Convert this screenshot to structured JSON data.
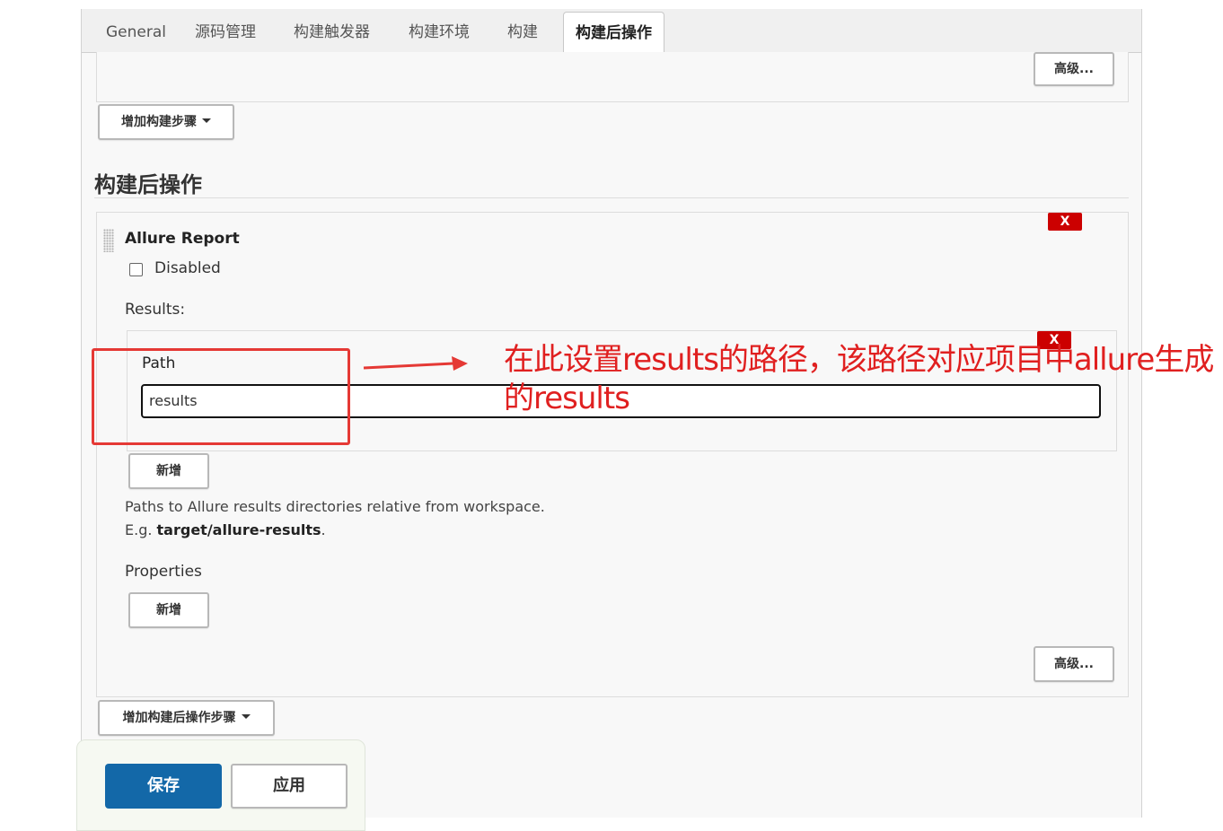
{
  "tabs": [
    "General",
    "源码管理",
    "构建触发器",
    "构建环境",
    "构建",
    "构建后操作"
  ],
  "active_tab": "构建后操作",
  "build_section": {
    "advanced_label": "高级...",
    "add_build_step_label": "增加构建步骤"
  },
  "post_build": {
    "title": "构建后操作",
    "allure": {
      "name": "Allure Report",
      "remove_label": "X",
      "disabled_label": "Disabled",
      "disabled_checked": false,
      "results_label": "Results:",
      "path_remove_label": "X",
      "path_label": "Path",
      "path_value": "results",
      "add_result_label": "新增",
      "help_line1": "Paths to Allure results directories relative from workspace.",
      "help_eg_prefix": "E.g.",
      "help_eg_value": "target/allure-results",
      "help_eg_suffix": ".",
      "properties_label": "Properties",
      "add_property_label": "新增",
      "advanced_label": "高级..."
    },
    "add_post_build_label": "增加构建后操作步骤"
  },
  "annotation": {
    "text": "在此设置results的路径，该路径对应项目中allure生成的results",
    "color": "#e02020"
  },
  "footer": {
    "save_label": "保存",
    "apply_label": "应用"
  },
  "colors": {
    "primary": "#1368a8",
    "danger": "#cc0000"
  }
}
